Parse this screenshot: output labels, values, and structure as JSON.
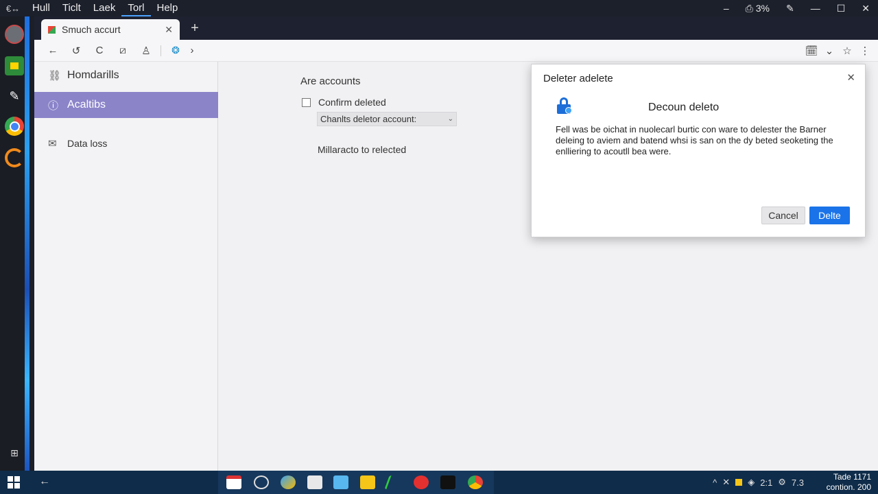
{
  "menubar": {
    "back_label": "€↔",
    "items": [
      "Hull",
      "Ticlt",
      "Laek",
      "Torl",
      "Help"
    ],
    "active_index": 3,
    "right": {
      "minimize": "–",
      "battery": "⎙ 3%",
      "edit": "✎",
      "min2": "—",
      "max": "☐",
      "close": "✕"
    }
  },
  "dock": {
    "icons": [
      "profile-icon",
      "sheets-icon",
      "pen-icon",
      "chrome-icon",
      "app-icon",
      "panel-icon"
    ]
  },
  "browser": {
    "tab": {
      "title": "Smuch accurt",
      "close": "✕"
    },
    "new_tab": "+",
    "toolbar": {
      "back": "←",
      "forward": "↺",
      "reload": "C",
      "b1": "⧄",
      "profile": "♙",
      "site": "❂",
      "chev": "›",
      "r1": "🗓",
      "r2": "⌄",
      "star": "☆",
      "more": "⋮"
    }
  },
  "sidebar": {
    "items": [
      {
        "label": "Homdarills",
        "icon": "⛓"
      },
      {
        "label": "Acaltibs",
        "icon": "ⓘ"
      },
      {
        "label": "Data loss",
        "icon": "✉"
      }
    ],
    "active_index": 1
  },
  "main": {
    "section_title": "Are accounts",
    "checkbox_label": "Confirm deleted",
    "select_value": "Chanlts deletor account:",
    "select_chevron": "⌄",
    "note": "Millaracto to relected"
  },
  "dialog": {
    "title": "Deleter adelete",
    "close": "✕",
    "heading": "Decoun deleto",
    "body": "Fell was be oichat in nuolecarl burtic con ware to delester the Barner deleing to aviem and batend whsi is san on the dy beted seoketing the enlliering to acoutll bea were.",
    "cancel_label": "Cancel",
    "delete_label": "Delte"
  },
  "taskbar": {
    "back": "←",
    "tray": {
      "caret": "^",
      "x": "✕",
      "shield": "◈",
      "time_left": "2:1",
      "gear": "⚙",
      "num": "7.3"
    },
    "clock_line1": "Tade 1171",
    "clock_line2": "contion. 200"
  }
}
